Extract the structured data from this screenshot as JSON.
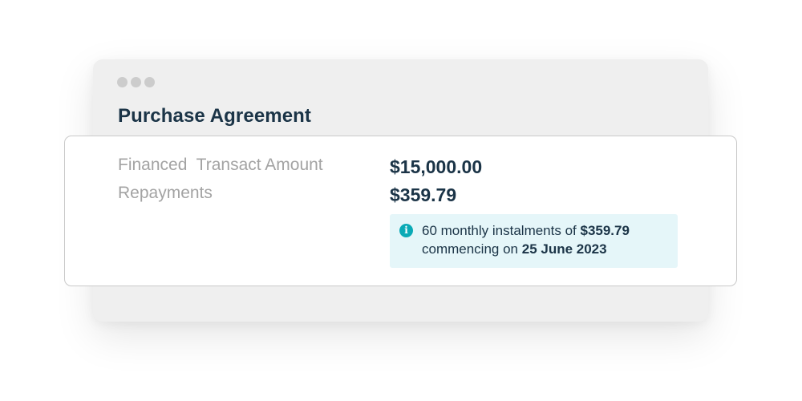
{
  "window": {
    "title": "Purchase Agreement"
  },
  "agreement": {
    "financed_label": "Financed  Transact Amount",
    "financed_value": "$15,000.00",
    "repayments_label": "Repayments",
    "repayments_value": "$359.79"
  },
  "info": {
    "icon": "info-icon",
    "line1_prefix": "60 monthly instalments of ",
    "line1_amount": "$359.79",
    "line2_prefix": "commencing on ",
    "line2_date": "25 June 2023"
  },
  "colors": {
    "heading": "#1b3447",
    "label": "#a3a3a3",
    "info_background": "#e5f6f9",
    "info_icon": "#0aaab6",
    "window_background": "#efefef"
  }
}
